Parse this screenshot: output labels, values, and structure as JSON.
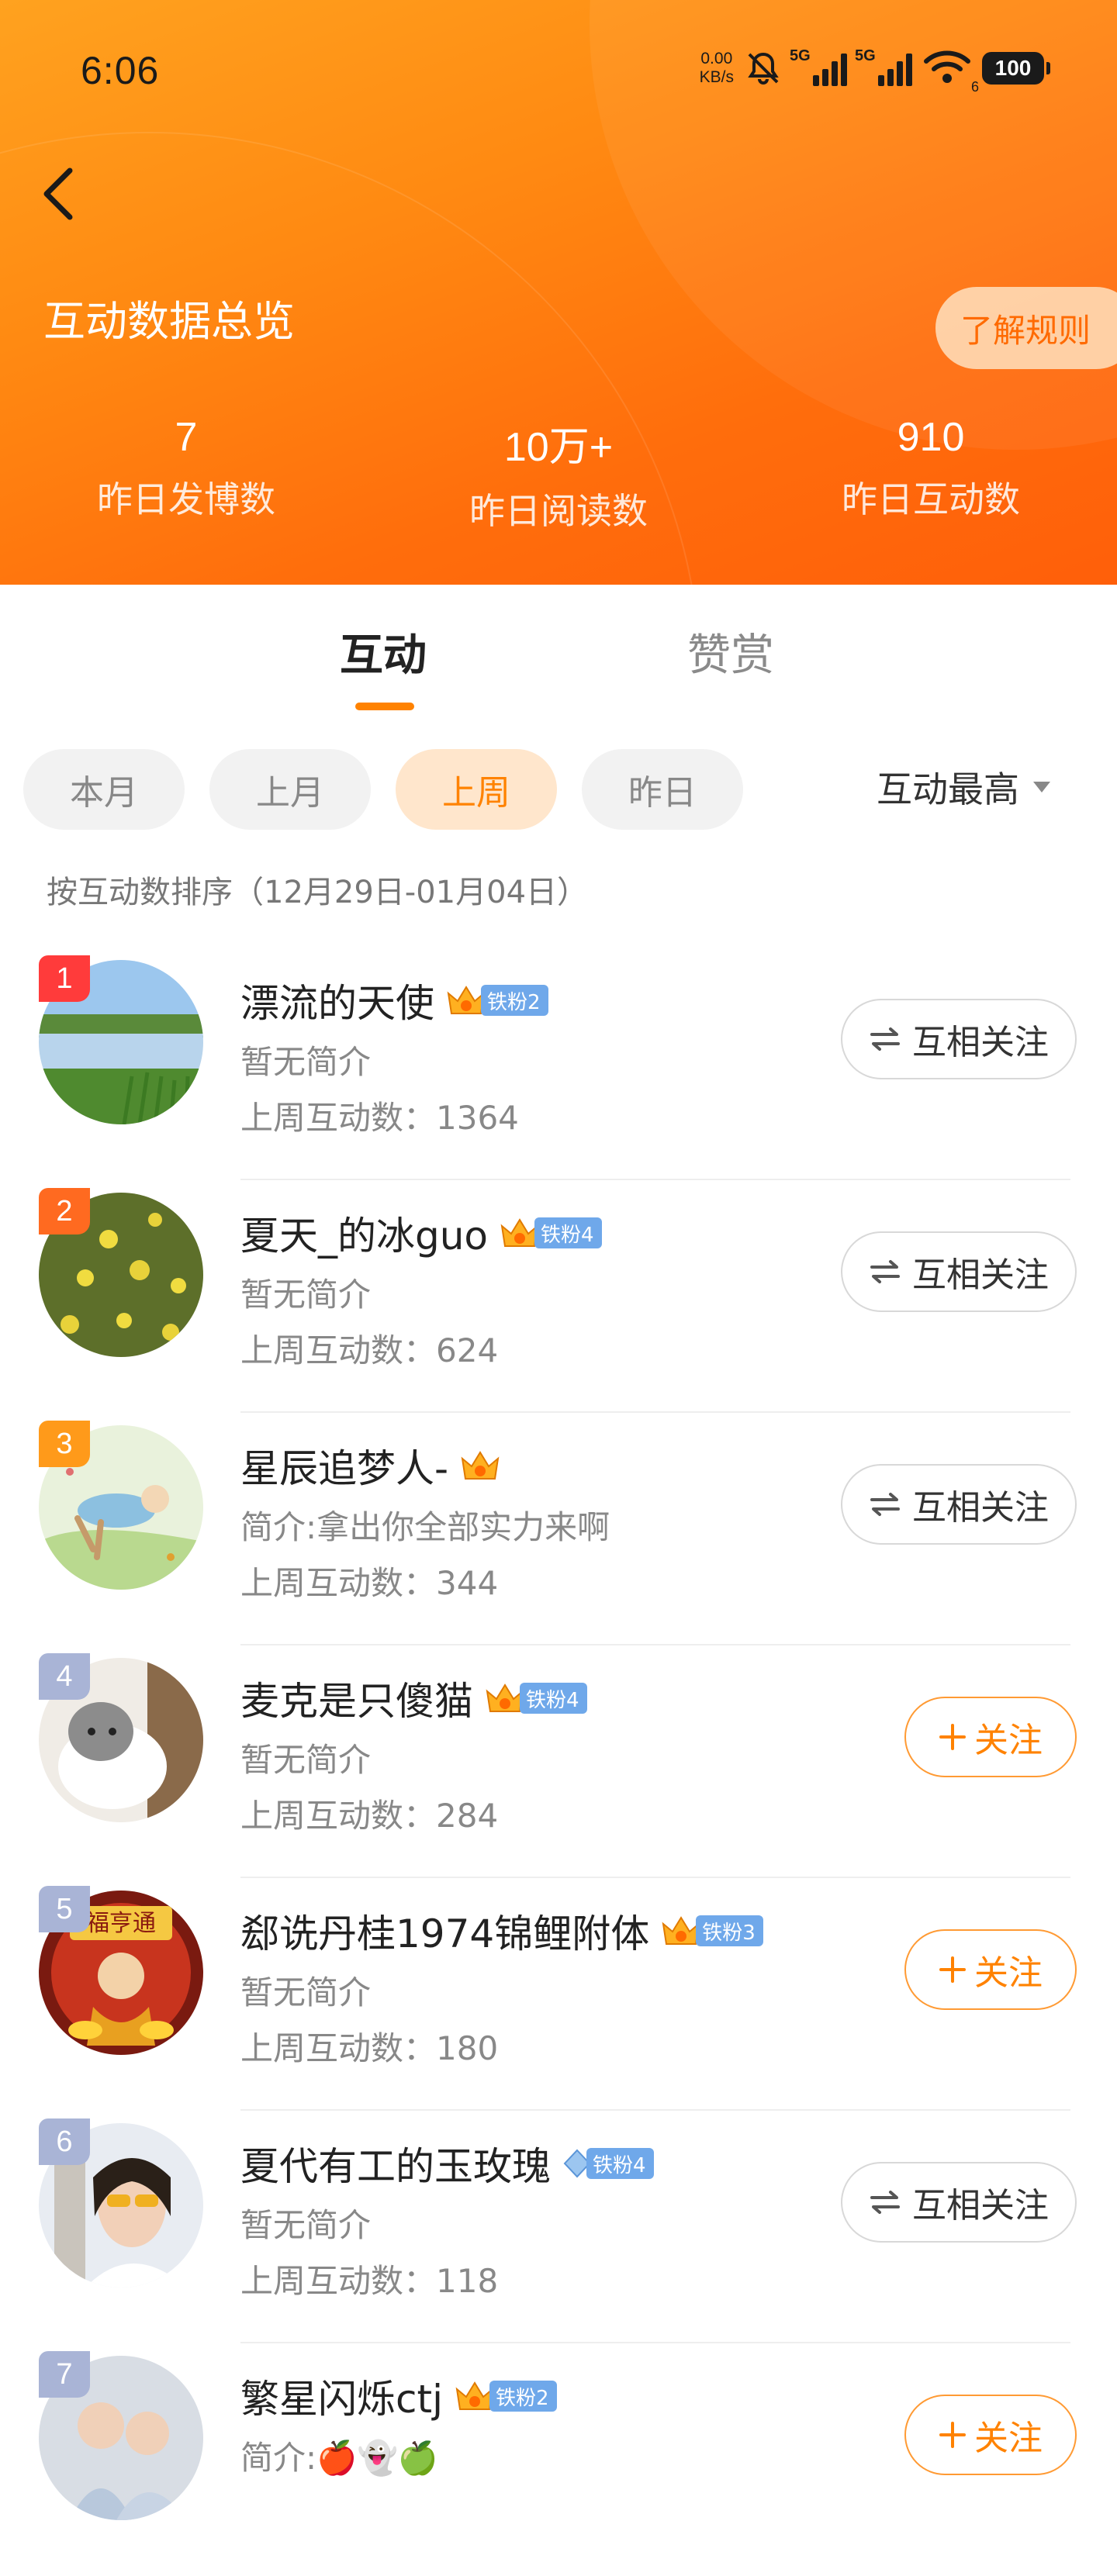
{
  "status_bar": {
    "time": "6:06",
    "net_speed_value": "0.00",
    "net_speed_unit": "KB/s",
    "signal1": "5G",
    "signal2": "5G",
    "wifi_label": "6",
    "battery": "100"
  },
  "header": {
    "title": "互动数据总览",
    "rules_button": "了解规则",
    "stats": [
      {
        "value": "7",
        "label": "昨日发博数"
      },
      {
        "value": "10万+",
        "label": "昨日阅读数"
      },
      {
        "value": "910",
        "label": "昨日互动数"
      }
    ]
  },
  "tabs": [
    {
      "label": "互动",
      "active": true
    },
    {
      "label": "赞赏",
      "active": false
    }
  ],
  "filters": [
    {
      "label": "本月",
      "active": false
    },
    {
      "label": "上月",
      "active": false
    },
    {
      "label": "上周",
      "active": true
    },
    {
      "label": "昨日",
      "active": false
    }
  ],
  "sort": {
    "label": "互动最高"
  },
  "range_note": "按互动数排序（12月29日-01月04日）",
  "list": [
    {
      "rank": "1",
      "name": "漂流的天使",
      "badge": "铁粉2",
      "bio": "暂无简介",
      "count": "上周互动数：1364",
      "action": "互相关注"
    },
    {
      "rank": "2",
      "name": "夏天_的冰guo",
      "badge": "铁粉4",
      "bio": "暂无简介",
      "count": "上周互动数：624",
      "action": "互相关注"
    },
    {
      "rank": "3",
      "name": "星辰追梦人-",
      "badge": "",
      "bio": "简介:拿出你全部实力来啊",
      "count": "上周互动数：344",
      "action": "互相关注"
    },
    {
      "rank": "4",
      "name": "麦克是只傻猫",
      "badge": "铁粉4",
      "bio": "暂无简介",
      "count": "上周互动数：284",
      "action": "关注"
    },
    {
      "rank": "5",
      "name": "郄诜丹桂1974锦鲤附体",
      "badge": "铁粉3",
      "bio": "暂无简介",
      "count": "上周互动数：180",
      "action": "关注"
    },
    {
      "rank": "6",
      "name": "夏代有工的玉玫瑰",
      "badge": "铁粉4",
      "bio": "暂无简介",
      "count": "上周互动数：118",
      "action": "互相关注"
    },
    {
      "rank": "7",
      "name": "繁星闪烁ctj",
      "badge": "铁粉2",
      "bio": "简介:🍎👻🍏",
      "count": "",
      "action": "关注"
    }
  ],
  "avatar_sign_text": "福亨通",
  "colors": {
    "accent": "#ff8200",
    "header_start": "#ffa21f",
    "header_end": "#ff5f0a",
    "fan_badge": "#6fa8ea"
  }
}
